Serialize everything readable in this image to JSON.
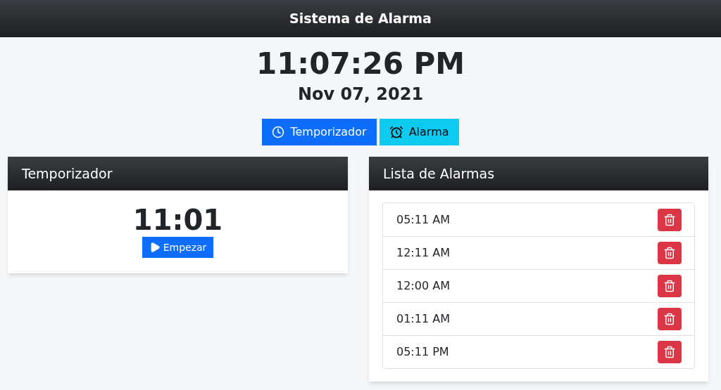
{
  "header": {
    "title": "Sistema de Alarma"
  },
  "clock": {
    "time": "11:07:26 PM",
    "date": "Nov 07, 2021"
  },
  "mode_buttons": [
    {
      "label": "Temporizador",
      "kind": "timer"
    },
    {
      "label": "Alarma",
      "kind": "alarm"
    }
  ],
  "timer_card": {
    "title": "Temporizador",
    "value": "11:01",
    "start_button": "Empezar"
  },
  "alarm_card": {
    "title": "Lista de Alarmas",
    "alarms": [
      {
        "time": "05:11 AM"
      },
      {
        "time": "12:11 AM"
      },
      {
        "time": "12:00 AM"
      },
      {
        "time": "01:11 AM"
      },
      {
        "time": "05:11 PM"
      }
    ]
  }
}
